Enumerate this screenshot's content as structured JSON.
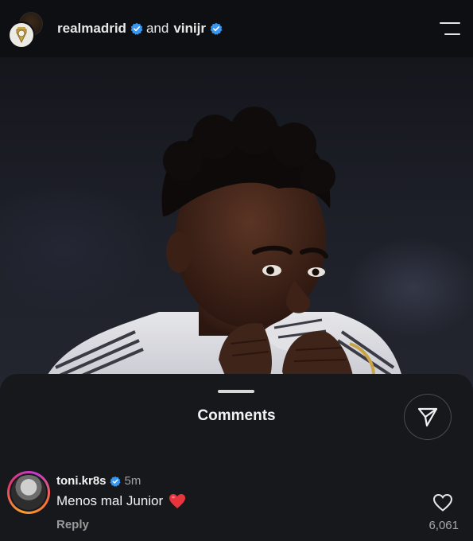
{
  "header": {
    "account_1": "realmadrid",
    "joiner": "and",
    "account_2": "vinijr"
  },
  "post": {
    "image_icon": "photo-of-player"
  },
  "comments_sheet": {
    "title": "Comments",
    "share_icon": "send-icon"
  },
  "comment": {
    "username": "toni.kr8s",
    "time": "5m",
    "text": "Menos mal Junior",
    "emoji_icon": "red-heart-icon",
    "reply_label": "Reply",
    "like_count": "6,061"
  },
  "colors": {
    "verified": "#3897f0",
    "heart": "#e8343c",
    "background": "#000000",
    "sheet": "#17181c"
  }
}
